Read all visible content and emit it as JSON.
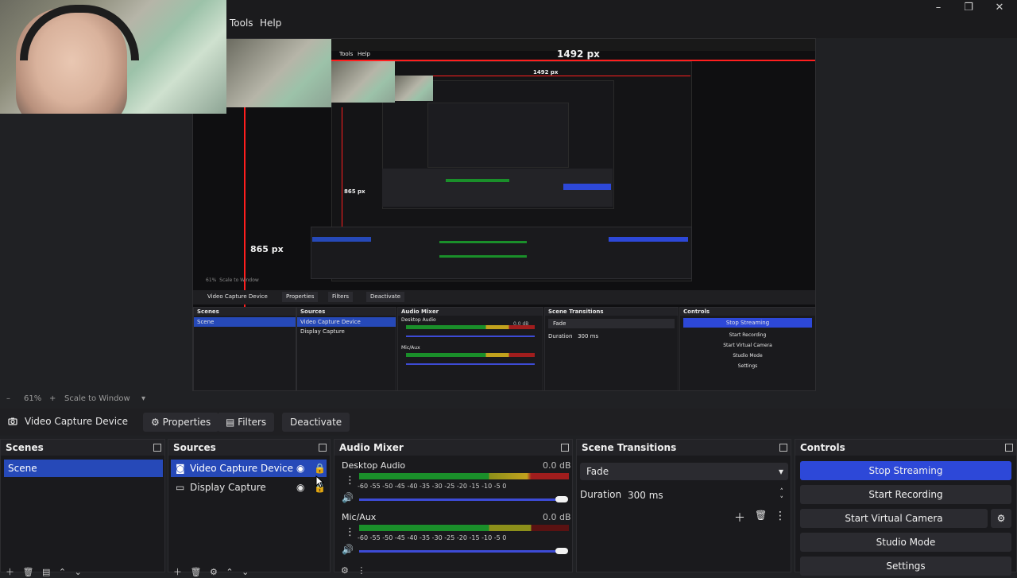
{
  "menu": {
    "tools": "Tools",
    "help": "Help"
  },
  "window_controls": {
    "minimize": "–",
    "maximize": "❐",
    "close": "✕"
  },
  "preview": {
    "width_label": "1492 px",
    "height_label": "865 px",
    "nested_width_label": "1492 px",
    "nested_height_label": "865 px",
    "nested_tools": "Tools",
    "nested_help": "Help",
    "nested_zoom": "61%",
    "nested_scale": "Scale to Window",
    "nested_source": "Video Capture Device",
    "nested_properties": "Properties",
    "nested_filters": "Filters",
    "nested_deactivate": "Deactivate",
    "nested_scenes": "Scenes",
    "nested_sources": "Sources",
    "nested_audio": "Audio Mixer",
    "nested_transitions": "Scene Transitions",
    "nested_controls": "Controls",
    "nested_scene": "Scene",
    "nested_video": "Video Capture Device",
    "nested_display": "Display Capture",
    "nested_desktop": "Desktop Audio",
    "nested_mic": "Mic/Aux",
    "nested_db": "0.0 dB",
    "nested_fade": "Fade",
    "nested_duration": "Duration",
    "nested_ms": "300 ms",
    "nested_stop": "Stop Streaming",
    "nested_record": "Start Recording",
    "nested_vcam": "Start Virtual Camera",
    "nested_studio": "Studio Mode",
    "nested_settings": "Settings"
  },
  "zoom": {
    "minus": "–",
    "value": "61%",
    "plus": "+",
    "mode": "Scale to Window"
  },
  "source_toolbar": {
    "source_name": "Video Capture Device",
    "properties": "Properties",
    "filters": "Filters",
    "deactivate": "Deactivate"
  },
  "scenes": {
    "title": "Scenes",
    "items": [
      "Scene"
    ]
  },
  "sources": {
    "title": "Sources",
    "items": [
      "Video Capture Device",
      "Display Capture"
    ]
  },
  "audio": {
    "title": "Audio Mixer",
    "channels": [
      {
        "name": "Desktop Audio",
        "db": "0.0 dB"
      },
      {
        "name": "Mic/Aux",
        "db": "0.0 dB"
      }
    ],
    "ticks": "-60  -55  -50  -45  -40  -35  -30  -25  -20  -15  -10   -5    0"
  },
  "transitions": {
    "title": "Scene Transitions",
    "selected": "Fade",
    "duration_label": "Duration",
    "duration_value": "300 ms"
  },
  "controls": {
    "title": "Controls",
    "stop_streaming": "Stop Streaming",
    "start_recording": "Start Recording",
    "start_virtual_camera": "Start Virtual Camera",
    "studio_mode": "Studio Mode",
    "settings": "Settings"
  },
  "colors": {
    "accent": "#2d48d8",
    "selection": "#2649b8",
    "red_guide": "#ff1e1e"
  }
}
